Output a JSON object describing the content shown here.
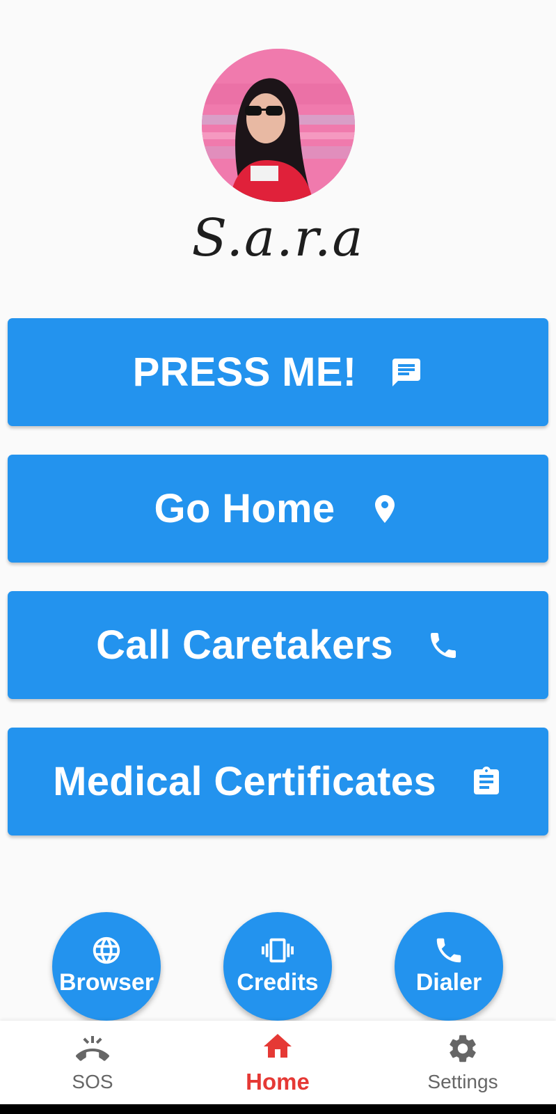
{
  "profile": {
    "name_signature": "S.a.r.a"
  },
  "actions": [
    {
      "label": "PRESS ME!",
      "icon": "message-icon"
    },
    {
      "label": "Go Home",
      "icon": "location-pin-icon"
    },
    {
      "label": "Call Caretakers",
      "icon": "phone-icon"
    },
    {
      "label": "Medical Certificates",
      "icon": "clipboard-icon"
    }
  ],
  "quick_buttons": [
    {
      "label": "Browser",
      "icon": "globe-icon"
    },
    {
      "label": "Credits",
      "icon": "vibrate-icon"
    },
    {
      "label": "Dialer",
      "icon": "phone-icon"
    }
  ],
  "bottom_nav": {
    "items": [
      {
        "label": "SOS",
        "icon": "ringing-phone-icon",
        "active": false
      },
      {
        "label": "Home",
        "icon": "home-icon",
        "active": true
      },
      {
        "label": "Settings",
        "icon": "gear-icon",
        "active": false
      }
    ]
  },
  "colors": {
    "primary": "#2393ee",
    "active_nav": "#e53935",
    "inactive_nav": "#666666",
    "background": "#fafafa"
  }
}
